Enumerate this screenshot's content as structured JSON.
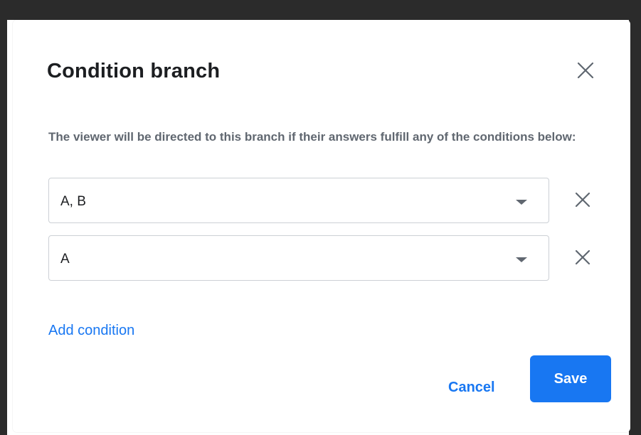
{
  "dialog": {
    "title": "Condition branch",
    "close_icon": "close-icon",
    "description": "The viewer will be directed to this branch if their answers fulfill any of the conditions below:"
  },
  "conditions": [
    {
      "value": "A, B",
      "arrow_icon": "caret-down-icon",
      "remove_icon": "close-icon"
    },
    {
      "value": "A",
      "arrow_icon": "caret-down-icon",
      "remove_icon": "close-icon"
    }
  ],
  "add_condition_label": "Add condition",
  "footer": {
    "cancel_label": "Cancel",
    "save_label": "Save"
  },
  "colors": {
    "accent": "#1877f2",
    "title_text": "#1c1e21",
    "secondary_text": "#606770",
    "border": "#ccd0d5",
    "backdrop": "#2b2b2b"
  }
}
